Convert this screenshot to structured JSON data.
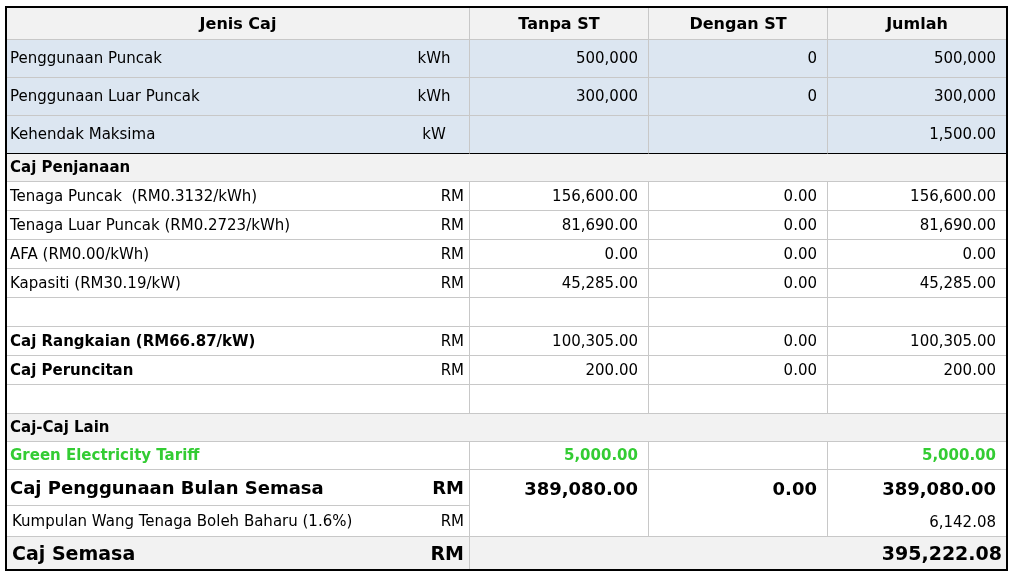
{
  "columns": [
    "Jenis Caj",
    "Tanpa ST",
    "Dengan ST",
    "Jumlah"
  ],
  "rows": [
    {
      "kind": "usage",
      "label": "Penggunaan Puncak",
      "unit": "kWh",
      "tanpa": "500,000",
      "dengan": "0",
      "jumlah": "500,000"
    },
    {
      "kind": "usage",
      "label": "Penggunaan Luar Puncak",
      "unit": "kWh",
      "tanpa": "300,000",
      "dengan": "0",
      "jumlah": "300,000"
    },
    {
      "kind": "usage",
      "label": "Kehendak Maksima",
      "unit": "kW",
      "jumlah": "1,500.00"
    },
    {
      "kind": "section",
      "label": "Caj Penjanaan"
    },
    {
      "kind": "charge",
      "label": "Tenaga Puncak  (RM0.3132/kWh)",
      "unit": "RM",
      "tanpa": "156,600.00",
      "dengan": "0.00",
      "jumlah": "156,600.00"
    },
    {
      "kind": "charge",
      "label": "Tenaga Luar Puncak (RM0.2723/kWh)",
      "unit": "RM",
      "tanpa": "81,690.00",
      "dengan": "0.00",
      "jumlah": "81,690.00"
    },
    {
      "kind": "charge",
      "label": "AFA (RM0.00/kWh)",
      "unit": "RM",
      "tanpa": "0.00",
      "dengan": "0.00",
      "jumlah": "0.00"
    },
    {
      "kind": "charge",
      "label": "Kapasiti (RM30.19/kW)",
      "unit": "RM",
      "tanpa": "45,285.00",
      "dengan": "0.00",
      "jumlah": "45,285.00"
    },
    {
      "kind": "blank"
    },
    {
      "kind": "charge_bold",
      "label": "Caj Rangkaian (RM66.87/kW)",
      "unit": "RM",
      "tanpa": "100,305.00",
      "dengan": "0.00",
      "jumlah": "100,305.00"
    },
    {
      "kind": "charge_bold",
      "label": "Caj Peruncitan",
      "unit": "RM",
      "tanpa": "200.00",
      "dengan": "0.00",
      "jumlah": "200.00"
    },
    {
      "kind": "blank"
    },
    {
      "kind": "section",
      "label": "Caj-Caj Lain"
    },
    {
      "kind": "green",
      "label": "Green Electricity Tariff",
      "tanpa": "5,000.00",
      "jumlah": "5,000.00"
    },
    {
      "kind": "subtotal",
      "label": "Caj Penggunaan Bulan Semasa",
      "unit": "RM",
      "tanpa": "389,080.00",
      "dengan": "0.00",
      "jumlah": "389,080.00"
    },
    {
      "kind": "fund",
      "label": "Kumpulan Wang Tenaga Boleh Baharu (1.6%)",
      "unit": "RM",
      "jumlah": "6,142.08"
    },
    {
      "kind": "total",
      "label": "Caj Semasa",
      "unit": "RM",
      "jumlah": "395,222.08"
    }
  ]
}
